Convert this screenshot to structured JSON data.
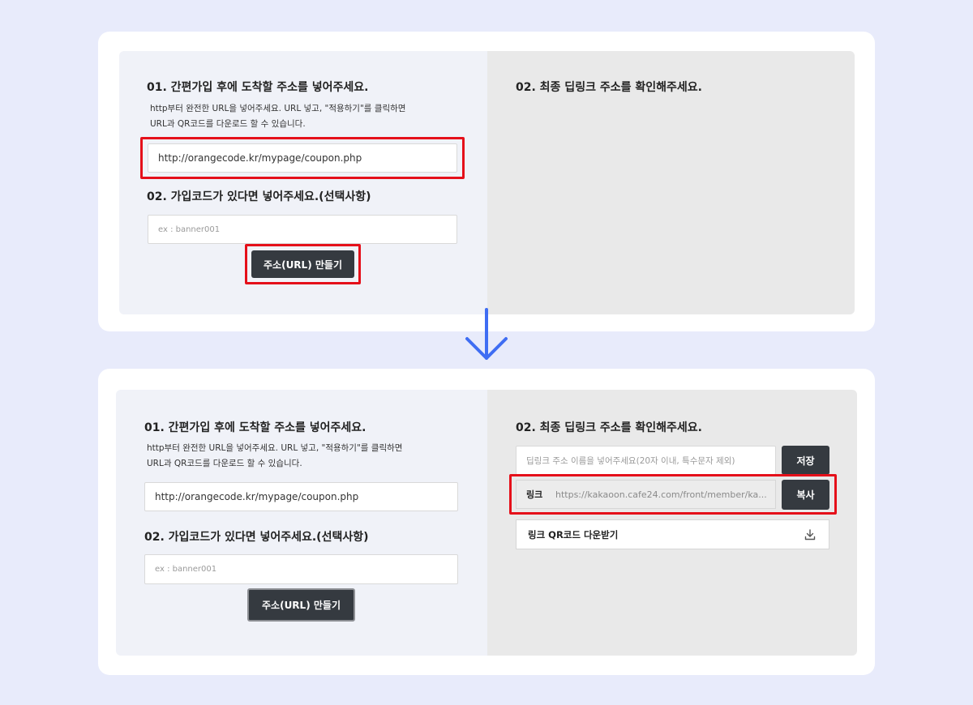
{
  "step1": {
    "left": {
      "heading1": "01. 간편가입 후에 도착할 주소를 넣어주세요.",
      "desc_line1": "http부터 완전한 URL을 넣어주세요. URL 넣고, \"적용하기\"를 클릭하면",
      "desc_line2": "URL과 QR코드를 다운로드 할 수 있습니다.",
      "url_value": "http://orangecode.kr/mypage/coupon.php",
      "heading2": "02. 가입코드가 있다면 넣어주세요.(선택사항)",
      "code_placeholder": "ex : banner001",
      "make_button": "주소(URL) 만들기"
    },
    "right": {
      "heading": "02. 최종 딥링크 주소를 확인해주세요."
    }
  },
  "step2": {
    "left": {
      "heading1": "01. 간편가입 후에 도착할 주소를 넣어주세요.",
      "desc_line1": "http부터 완전한 URL을 넣어주세요. URL 넣고, \"적용하기\"를 클릭하면",
      "desc_line2": "URL과 QR코드를 다운로드 할 수 있습니다.",
      "url_value": "http://orangecode.kr/mypage/coupon.php",
      "heading2": "02. 가입코드가 있다면 넣어주세요.(선택사항)",
      "code_placeholder": "ex : banner001",
      "make_button": "주소(URL) 만들기"
    },
    "right": {
      "heading": "02. 최종 딥링크 주소를 확인해주세요.",
      "name_placeholder": "딥링크 주소 이름을 넣어주세요(20자 이내, 특수문자 제외)",
      "save_button": "저장",
      "link_label": "링크",
      "link_value": "https://kakaoon.cafe24.com/front/member/ka...",
      "copy_button": "복사",
      "qr_download": "링크 QR코드 다운받기"
    }
  },
  "colors": {
    "page_bg": "#e8ebfb",
    "highlight": "#e5101a",
    "arrow": "#3f6df3",
    "dark_button": "#353a40"
  },
  "icons": {
    "arrow": "arrow-down-icon",
    "download": "download-icon"
  }
}
